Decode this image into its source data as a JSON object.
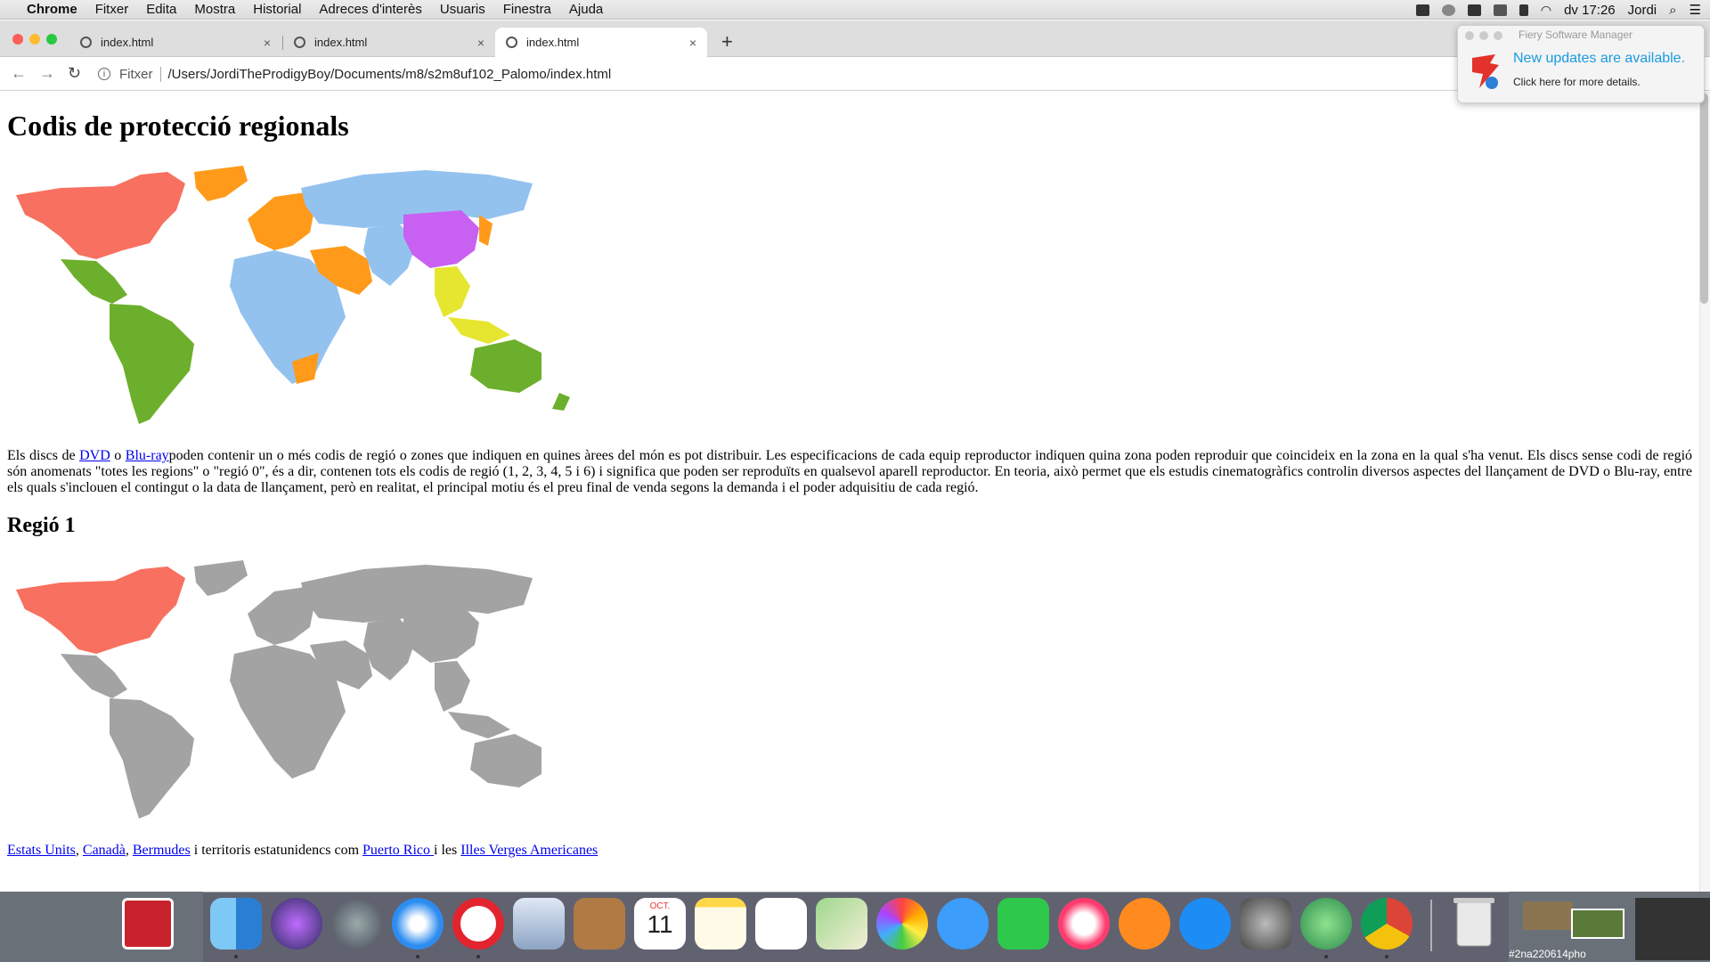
{
  "menubar": {
    "apple": "",
    "app": "Chrome",
    "items": [
      "Fitxer",
      "Edita",
      "Mostra",
      "Historial",
      "Adreces d'interès",
      "Usuaris",
      "Finestra",
      "Ajuda"
    ],
    "clock": "dv 17:26",
    "user": "Jordi"
  },
  "tabs": [
    {
      "title": "index.html",
      "active": false
    },
    {
      "title": "index.html",
      "active": false
    },
    {
      "title": "index.html",
      "active": true
    }
  ],
  "omnibox": {
    "scheme": "Fitxer",
    "path": "/Users/JordiTheProdigyBoy/Documents/m8/s2m8uf102_Palomo/index.html"
  },
  "notification": {
    "app": "Fiery Software Manager",
    "headline": "New updates are available.",
    "detail": "Click here for more details."
  },
  "page": {
    "title": "Codis de protecció regionals",
    "intro_parts": {
      "p1": "Els discs de ",
      "dvd": " DVD",
      "p2": " o ",
      "bluray": " Blu-ray",
      "p3": "poden contenir un o més codis de regió o zones que indiquen en quines àrees del món es pot distribuir. Les especificacions de cada equip reproductor indiquen quina zona poden reproduir que coincideix en la zona en la qual s'ha venut. Els discs sense codi de regió són anomenats \"totes les regions\" o \"regió 0\", és a dir, contenen tots els codis de regió (1, 2, 3, 4, 5 i 6) i significa que poden ser reproduïts en qualsevol aparell reproductor. En teoria, això permet que els estudis cinematogràfics controlin diversos aspectes del llançament de DVD o Blu-ray, entre els quals s'inclouen el contingut o la data de llançament, però en realitat, el principal motiu és el preu final de venda segons la demanda i el poder adquisitiu de cada regió."
    },
    "region1": {
      "heading": "Regió 1",
      "caption": {
        "us": " Estats Units",
        "sep1": ", ",
        "ca": " Canadà",
        "sep2": ", ",
        "bm": "Bermudes",
        "mid": " i territoris estatunidencs com ",
        "pr": "Puerto Rico ",
        "and": " i les ",
        "vi": "Illes Verges Americanes "
      }
    }
  },
  "region_colors": {
    "r1": "#f87060",
    "r2": "#ff9a1a",
    "r3": "#e6e630",
    "r4": "#6caf2c",
    "r5": "#94c2ef",
    "r6": "#c860f2",
    "other": "#a3a3a3"
  },
  "dock": {
    "calendar_month": "OCT.",
    "calendar_day": "11",
    "thumb_label": "#2na220614pho"
  }
}
